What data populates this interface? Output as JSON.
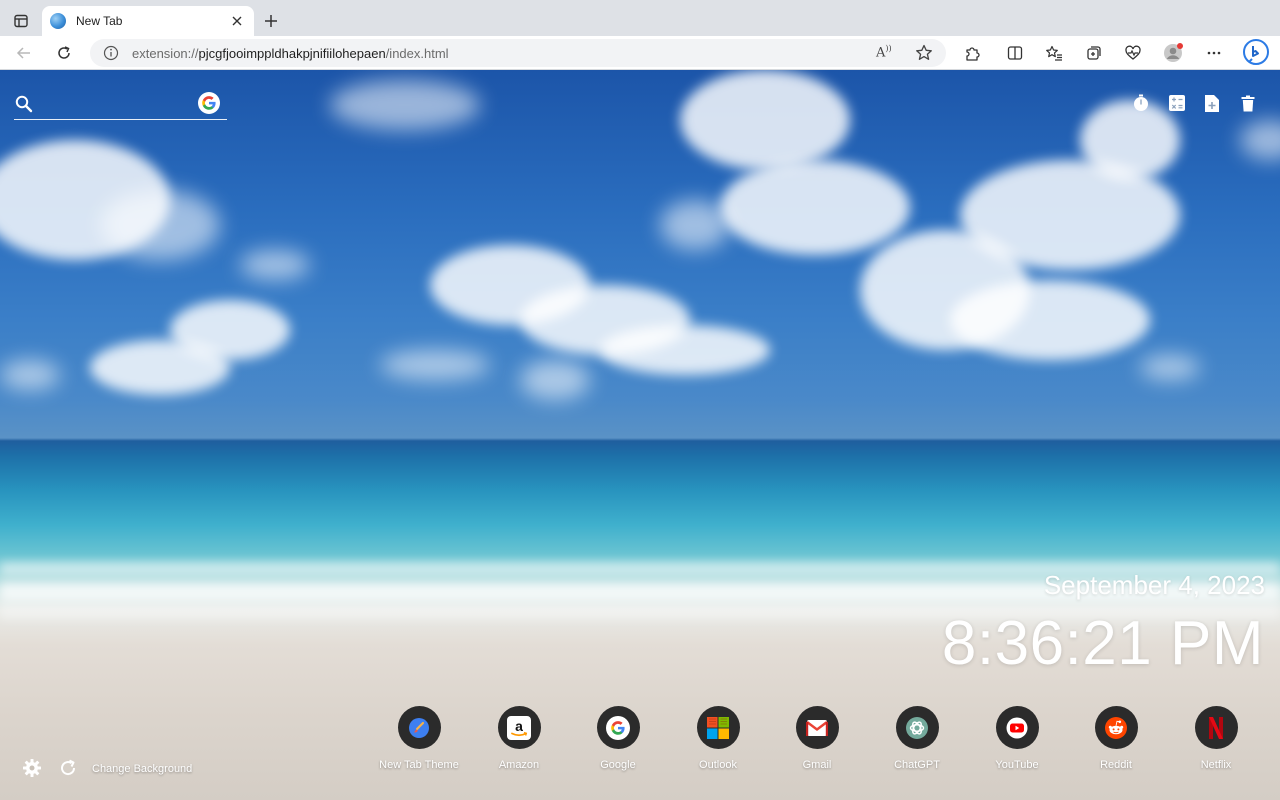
{
  "browser": {
    "tab": {
      "title": "New Tab"
    },
    "address_bar": {
      "prefix": "extension://",
      "host": "pjcgfjooimppldhakpjnifiilohepaen",
      "path": "/index.html"
    },
    "read_aloud_label": "A"
  },
  "page": {
    "search": {
      "placeholder": "",
      "value": "",
      "engine_icon": "google-g-icon"
    },
    "top_tools": [
      "timer-icon",
      "calculator-icon",
      "add-note-icon",
      "trash-icon"
    ],
    "date": "September 4, 2023",
    "time": "8:36:21 PM",
    "shortcuts": [
      {
        "label": "New Tab Theme",
        "icon": "paintbrush-icon"
      },
      {
        "label": "Amazon",
        "icon": "amazon-icon"
      },
      {
        "label": "Google",
        "icon": "google-icon"
      },
      {
        "label": "Outlook",
        "icon": "outlook-icon"
      },
      {
        "label": "Gmail",
        "icon": "gmail-icon"
      },
      {
        "label": "ChatGPT",
        "icon": "chatgpt-icon"
      },
      {
        "label": "YouTube",
        "icon": "youtube-icon"
      },
      {
        "label": "Reddit",
        "icon": "reddit-icon"
      },
      {
        "label": "Netflix",
        "icon": "netflix-icon"
      }
    ],
    "footer": {
      "change_background_label": "Change Background"
    }
  },
  "colors": {
    "tabstrip": "#dee1e6",
    "shortcut_circle": "#2b2b2b",
    "google_blue": "#4285f4",
    "google_red": "#ea4335",
    "google_yellow": "#fbbc05",
    "google_green": "#34a853",
    "youtube_red": "#ff0000",
    "reddit_orange": "#ff4500",
    "netflix_red": "#e50914"
  }
}
